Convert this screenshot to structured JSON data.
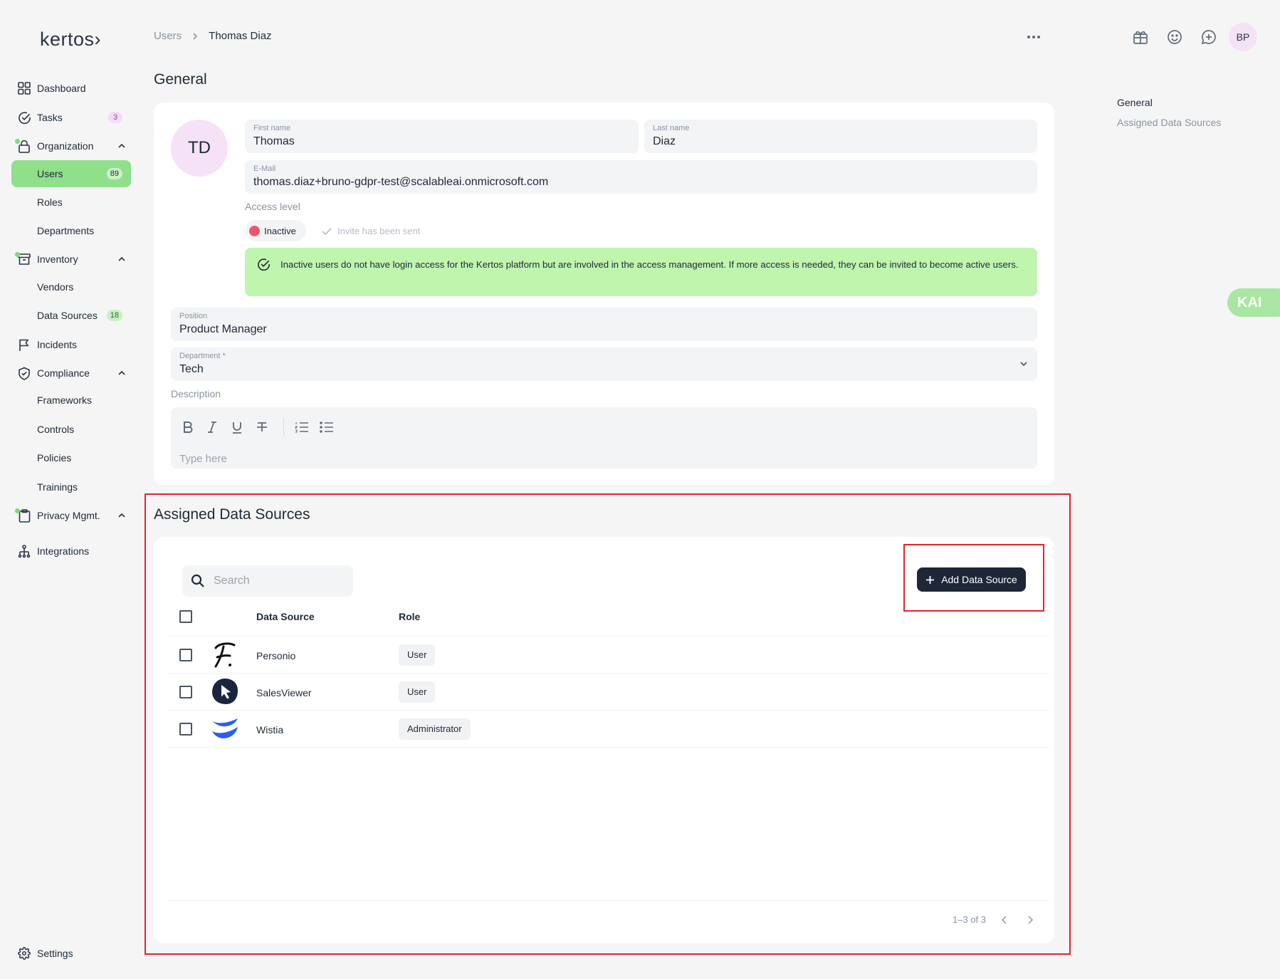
{
  "app": {
    "logo_text": "kertos›"
  },
  "sidebar": {
    "dashboard": "Dashboard",
    "tasks": {
      "label": "Tasks",
      "count": "3"
    },
    "organization": "Organization",
    "users": {
      "label": "Users",
      "count": "89"
    },
    "roles": "Roles",
    "departments": "Departments",
    "inventory": "Inventory",
    "vendors": "Vendors",
    "data_sources": {
      "label": "Data Sources",
      "count": "18"
    },
    "incidents": "Incidents",
    "compliance": "Compliance",
    "frameworks": "Frameworks",
    "controls": "Controls",
    "policies": "Policies",
    "trainings": "Trainings",
    "privacy": "Privacy Mgmt.",
    "integrations": "Integrations",
    "settings": "Settings"
  },
  "breadcrumb": {
    "parent": "Users",
    "current": "Thomas Diaz"
  },
  "header": {
    "user_initials": "BP"
  },
  "toc": {
    "general": "General",
    "assigned": "Assigned Data Sources"
  },
  "kai": "KAI",
  "general": {
    "title": "General",
    "initials": "TD",
    "first_name_label": "First name",
    "first_name": "Thomas",
    "last_name_label": "Last name",
    "last_name": "Diaz",
    "email_label": "E-Mail",
    "email": "thomas.diaz+bruno-gdpr-test@scalableai.onmicrosoft.com",
    "access_level_label": "Access level",
    "status": "Inactive",
    "invite_text": "Invite has been sent",
    "info_text": "Inactive users do not have login access for the Kertos platform but are involved in the access management. If more access is needed, they can be invited to become active users.",
    "position_label": "Position",
    "position": "Product Manager",
    "department_label": "Department *",
    "department": "Tech",
    "description_label": "Description",
    "description_placeholder": "Type here"
  },
  "assigned": {
    "title": "Assigned Data Sources",
    "search_placeholder": "Search",
    "add_button": "Add Data Source",
    "columns": {
      "source": "Data Source",
      "role": "Role"
    },
    "rows": [
      {
        "name": "Personio",
        "role": "User",
        "logo": "personio-logo"
      },
      {
        "name": "SalesViewer",
        "role": "User",
        "logo": "salesviewer-logo"
      },
      {
        "name": "Wistia",
        "role": "Administrator",
        "logo": "wistia-logo"
      }
    ],
    "pagination": "1–3 of 3"
  },
  "colors": {
    "accent_green": "#90df8b",
    "alert_green": "#bff5ad",
    "primary_dark": "#1e2638",
    "inactive_red": "#f0566b",
    "annotation_red": "#e0242e"
  }
}
